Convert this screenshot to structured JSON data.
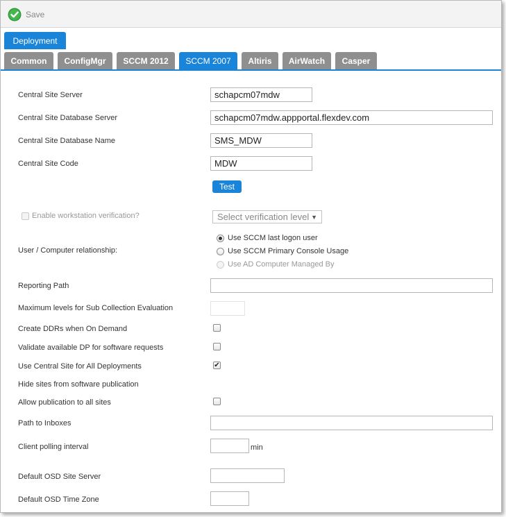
{
  "toolbar": {
    "save_label": "Save",
    "save_icon": "green-check-circle-icon"
  },
  "tabs": {
    "deployment": "Deployment"
  },
  "subtabs": [
    {
      "label": "Common",
      "active": false
    },
    {
      "label": "ConfigMgr",
      "active": false
    },
    {
      "label": "SCCM 2012",
      "active": false
    },
    {
      "label": "SCCM 2007",
      "active": true
    },
    {
      "label": "Altiris",
      "active": false
    },
    {
      "label": "AirWatch",
      "active": false
    },
    {
      "label": "Casper",
      "active": false
    }
  ],
  "form": {
    "central_site_server": {
      "label": "Central Site Server",
      "value": "schapcm07mdw"
    },
    "central_site_db_server": {
      "label": "Central Site Database Server",
      "value": "schapcm07mdw.appportal.flexdev.com"
    },
    "central_site_db_name": {
      "label": "Central Site Database Name",
      "value": "SMS_MDW"
    },
    "central_site_code": {
      "label": "Central Site Code",
      "value": "MDW"
    },
    "test_button": "Test",
    "workstation_verification": {
      "label": "Enable workstation verification?",
      "checked": false,
      "disabled": true
    },
    "verification_level": {
      "selected": "Select verification level"
    },
    "user_computer_relationship": {
      "label": "User / Computer relationship:",
      "options": [
        {
          "label": "Use SCCM last logon user",
          "checked": true,
          "disabled": false
        },
        {
          "label": "Use SCCM Primary Console Usage",
          "checked": false,
          "disabled": false
        },
        {
          "label": "Use AD Computer Managed By",
          "checked": false,
          "disabled": true
        }
      ]
    },
    "reporting_path": {
      "label": "Reporting Path",
      "value": ""
    },
    "max_levels": {
      "label": "Maximum levels for Sub Collection Evaluation",
      "value": ""
    },
    "create_ddrs": {
      "label": "Create DDRs when On Demand",
      "checked": false
    },
    "validate_dp": {
      "label": "Validate available DP for software requests",
      "checked": false
    },
    "use_central_site": {
      "label": "Use Central Site for All Deployments",
      "checked": true
    },
    "hide_sites": {
      "label": "Hide sites from software publication"
    },
    "allow_publication": {
      "label": "Allow publication to all sites",
      "checked": false
    },
    "path_to_inboxes": {
      "label": "Path to Inboxes",
      "value": ""
    },
    "client_polling": {
      "label": "Client polling interval",
      "value": "",
      "unit": "min"
    },
    "default_osd_site_server": {
      "label": "Default OSD Site Server",
      "value": ""
    },
    "default_osd_time_zone": {
      "label": "Default OSD Time Zone",
      "value": ""
    }
  },
  "colors": {
    "accent": "#1a84d8",
    "tab_inactive": "#8f8f8f",
    "save_icon": "#3fae49"
  }
}
